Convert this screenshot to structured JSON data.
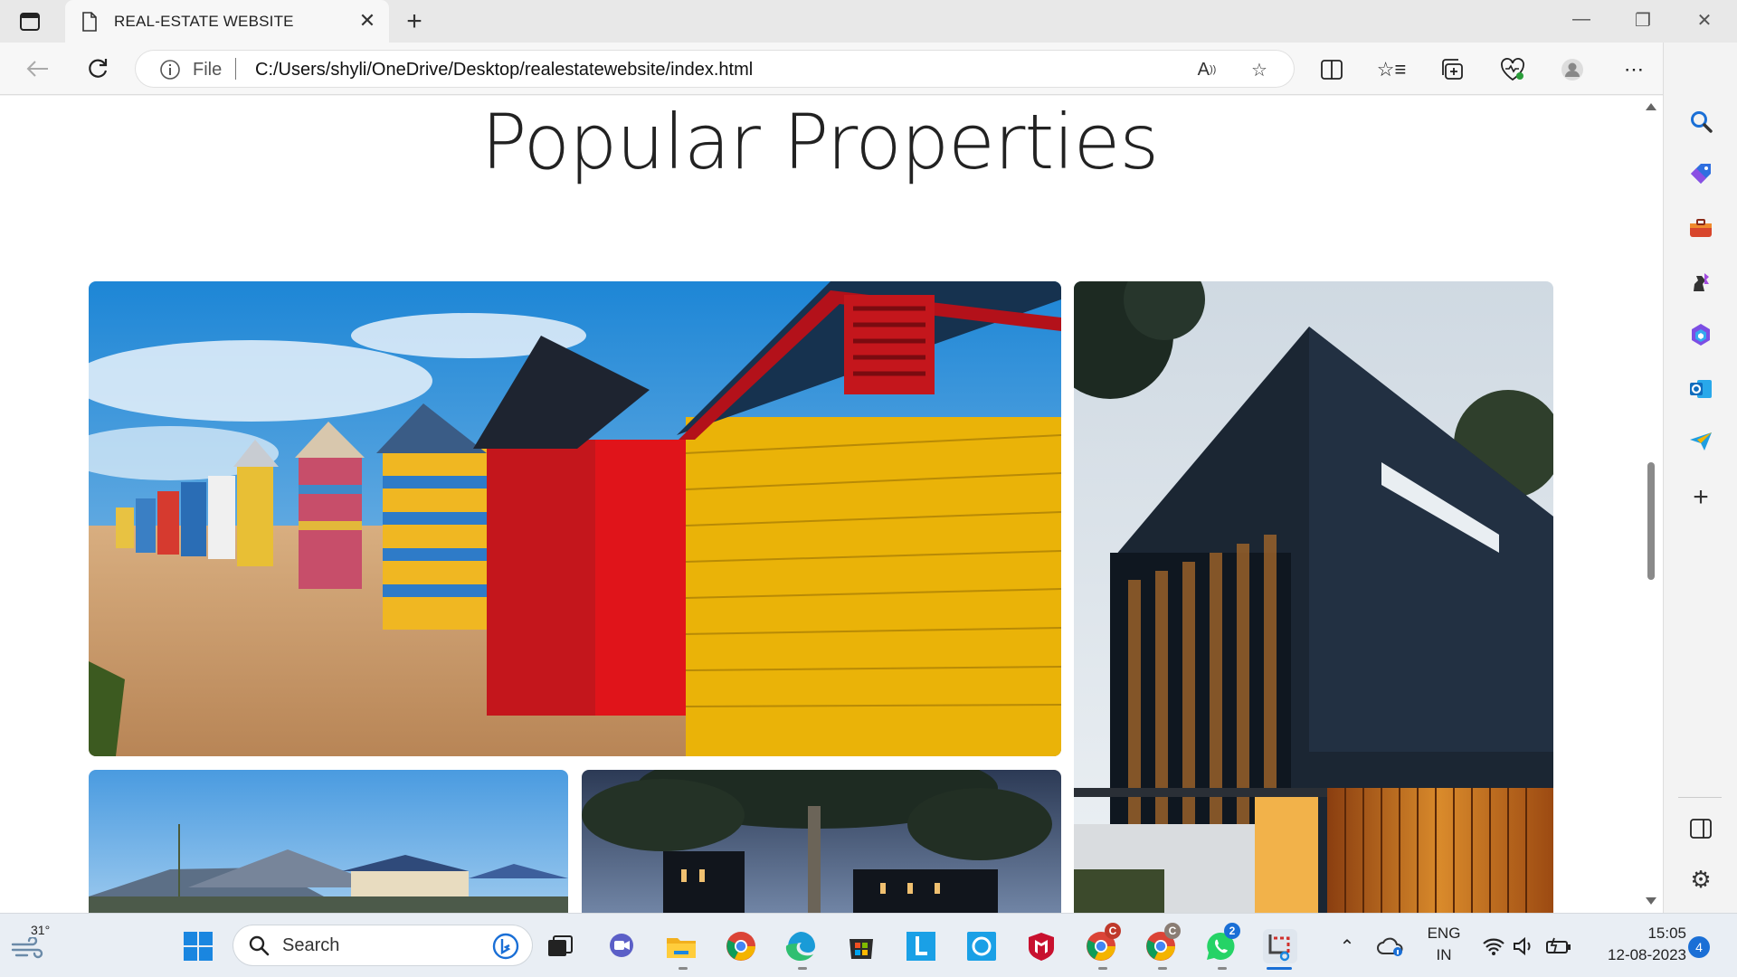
{
  "browser": {
    "tab_title": "REAL-ESTATE WEBSITE",
    "address": {
      "scheme_label": "File",
      "url": "C:/Users/shyli/OneDrive/Desktop/realestatewebsite/index.html"
    }
  },
  "page": {
    "heading": "Popular Properties",
    "properties": [
      {
        "name": "colorful-beach-huts"
      },
      {
        "name": "modern-dark-house"
      },
      {
        "name": "suburban-houses"
      },
      {
        "name": "modern-house-with-tree"
      }
    ]
  },
  "taskbar": {
    "weather_temp": "31°",
    "search_label": "Search",
    "language_line1": "ENG",
    "language_line2": "IN",
    "time": "15:05",
    "date": "12-08-2023",
    "notification_count": "4",
    "whatsapp_badge": "2",
    "chrome_profile_badge": "C"
  },
  "colors": {
    "accent": "#0a64c8",
    "tab_bg": "#f7f7f7",
    "taskbar_bg": "#e9eef4"
  }
}
